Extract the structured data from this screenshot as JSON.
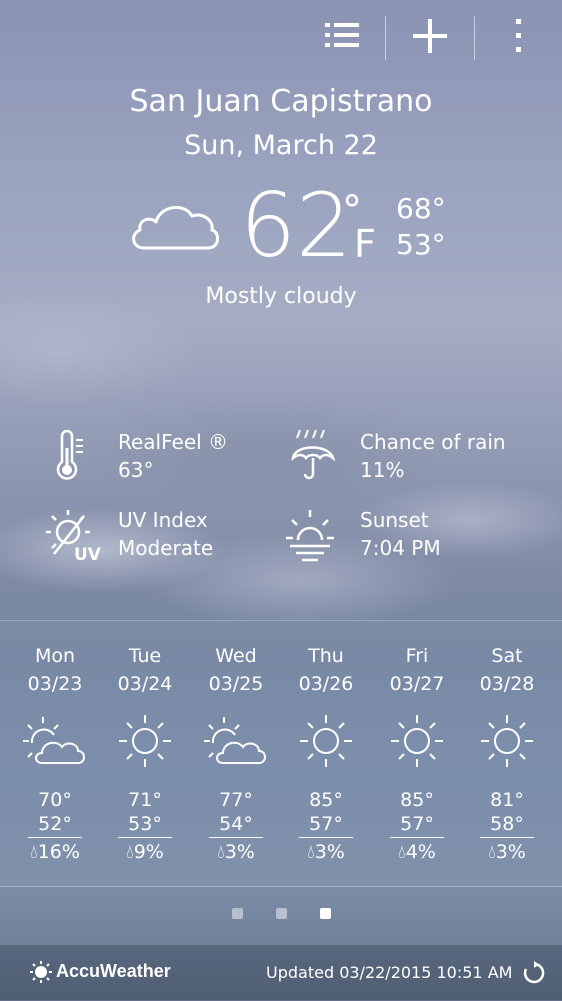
{
  "location": {
    "city": "San Juan Capistrano",
    "date": "Sun, March 22"
  },
  "current": {
    "temp": "62",
    "degree": "°",
    "unit": "F",
    "high": "68°",
    "low": "53°",
    "condition": "Mostly cloudy",
    "icon": "cloud-icon"
  },
  "details": {
    "realfeel": {
      "label": "RealFeel ®",
      "value": "63°",
      "icon": "thermometer-icon"
    },
    "rain": {
      "label": "Chance of rain",
      "value": "11%",
      "icon": "umbrella-rain-icon"
    },
    "uv": {
      "label": "UV Index",
      "value": "Moderate",
      "icon": "uv-icon",
      "badge": "UV"
    },
    "sunset": {
      "label": "Sunset",
      "value": "7:04 PM",
      "icon": "sunset-icon"
    }
  },
  "forecast": [
    {
      "day": "Mon",
      "date": "03/23",
      "icon": "partly-cloudy-icon",
      "high": "70°",
      "low": "52°",
      "rain": "16%"
    },
    {
      "day": "Tue",
      "date": "03/24",
      "icon": "sun-icon",
      "high": "71°",
      "low": "53°",
      "rain": "9%"
    },
    {
      "day": "Wed",
      "date": "03/25",
      "icon": "partly-cloudy-icon",
      "high": "77°",
      "low": "54°",
      "rain": "3%"
    },
    {
      "day": "Thu",
      "date": "03/26",
      "icon": "sun-icon",
      "high": "85°",
      "low": "57°",
      "rain": "3%"
    },
    {
      "day": "Fri",
      "date": "03/27",
      "icon": "sun-icon",
      "high": "85°",
      "low": "57°",
      "rain": "4%"
    },
    {
      "day": "Sat",
      "date": "03/28",
      "icon": "sun-icon",
      "high": "81°",
      "low": "58°",
      "rain": "3%"
    }
  ],
  "pager": {
    "pages": 3,
    "active_index": 2
  },
  "footer": {
    "brand": "AccuWeather",
    "updated": "Updated 03/22/2015 10:51 AM"
  },
  "colors": {
    "dot_inactive": "#b8c0d0",
    "dot_active": "#ffffff"
  }
}
